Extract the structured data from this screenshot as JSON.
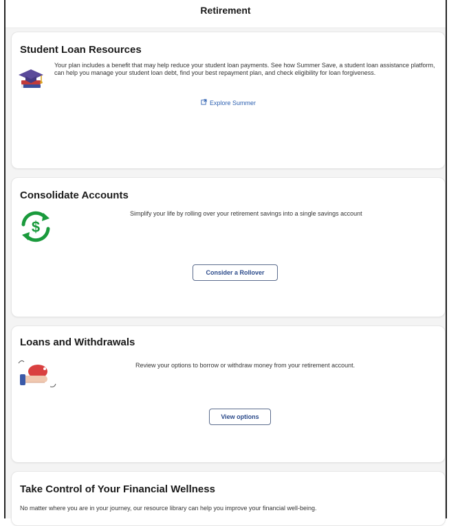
{
  "header": {
    "title": "Retirement"
  },
  "student_loan": {
    "title": "Student Loan Resources",
    "description": "Your plan includes a benefit that may help reduce your student loan payments. See how Summer Save, a student loan assistance platform, can help you manage your student loan debt, find your best repayment plan, and check eligibility for loan forgiveness.",
    "link_label": "Explore Summer",
    "icon": "graduation-cap-books-icon"
  },
  "consolidate": {
    "title": "Consolidate Accounts",
    "description": "Simplify your life by rolling over your retirement savings into a single savings account",
    "button_label": "Consider a Rollover",
    "icon": "dollar-cycle-icon",
    "accent": "#1a9a3c"
  },
  "loans": {
    "title": "Loans and Withdrawals",
    "description": "Review your options to borrow or withdraw money from your retirement account.",
    "button_label": "View options",
    "icon": "hand-piggy-bank-icon"
  },
  "wellness": {
    "title": "Take Control of Your Financial Wellness",
    "description": "No matter where you are in your journey, our resource library can help you improve your financial well-being."
  },
  "colors": {
    "link": "#2b5fb0",
    "button_text": "#2b4a8a",
    "green": "#1a9a3c",
    "card_bg": "#ffffff",
    "page_bg": "#f4f4f4"
  }
}
